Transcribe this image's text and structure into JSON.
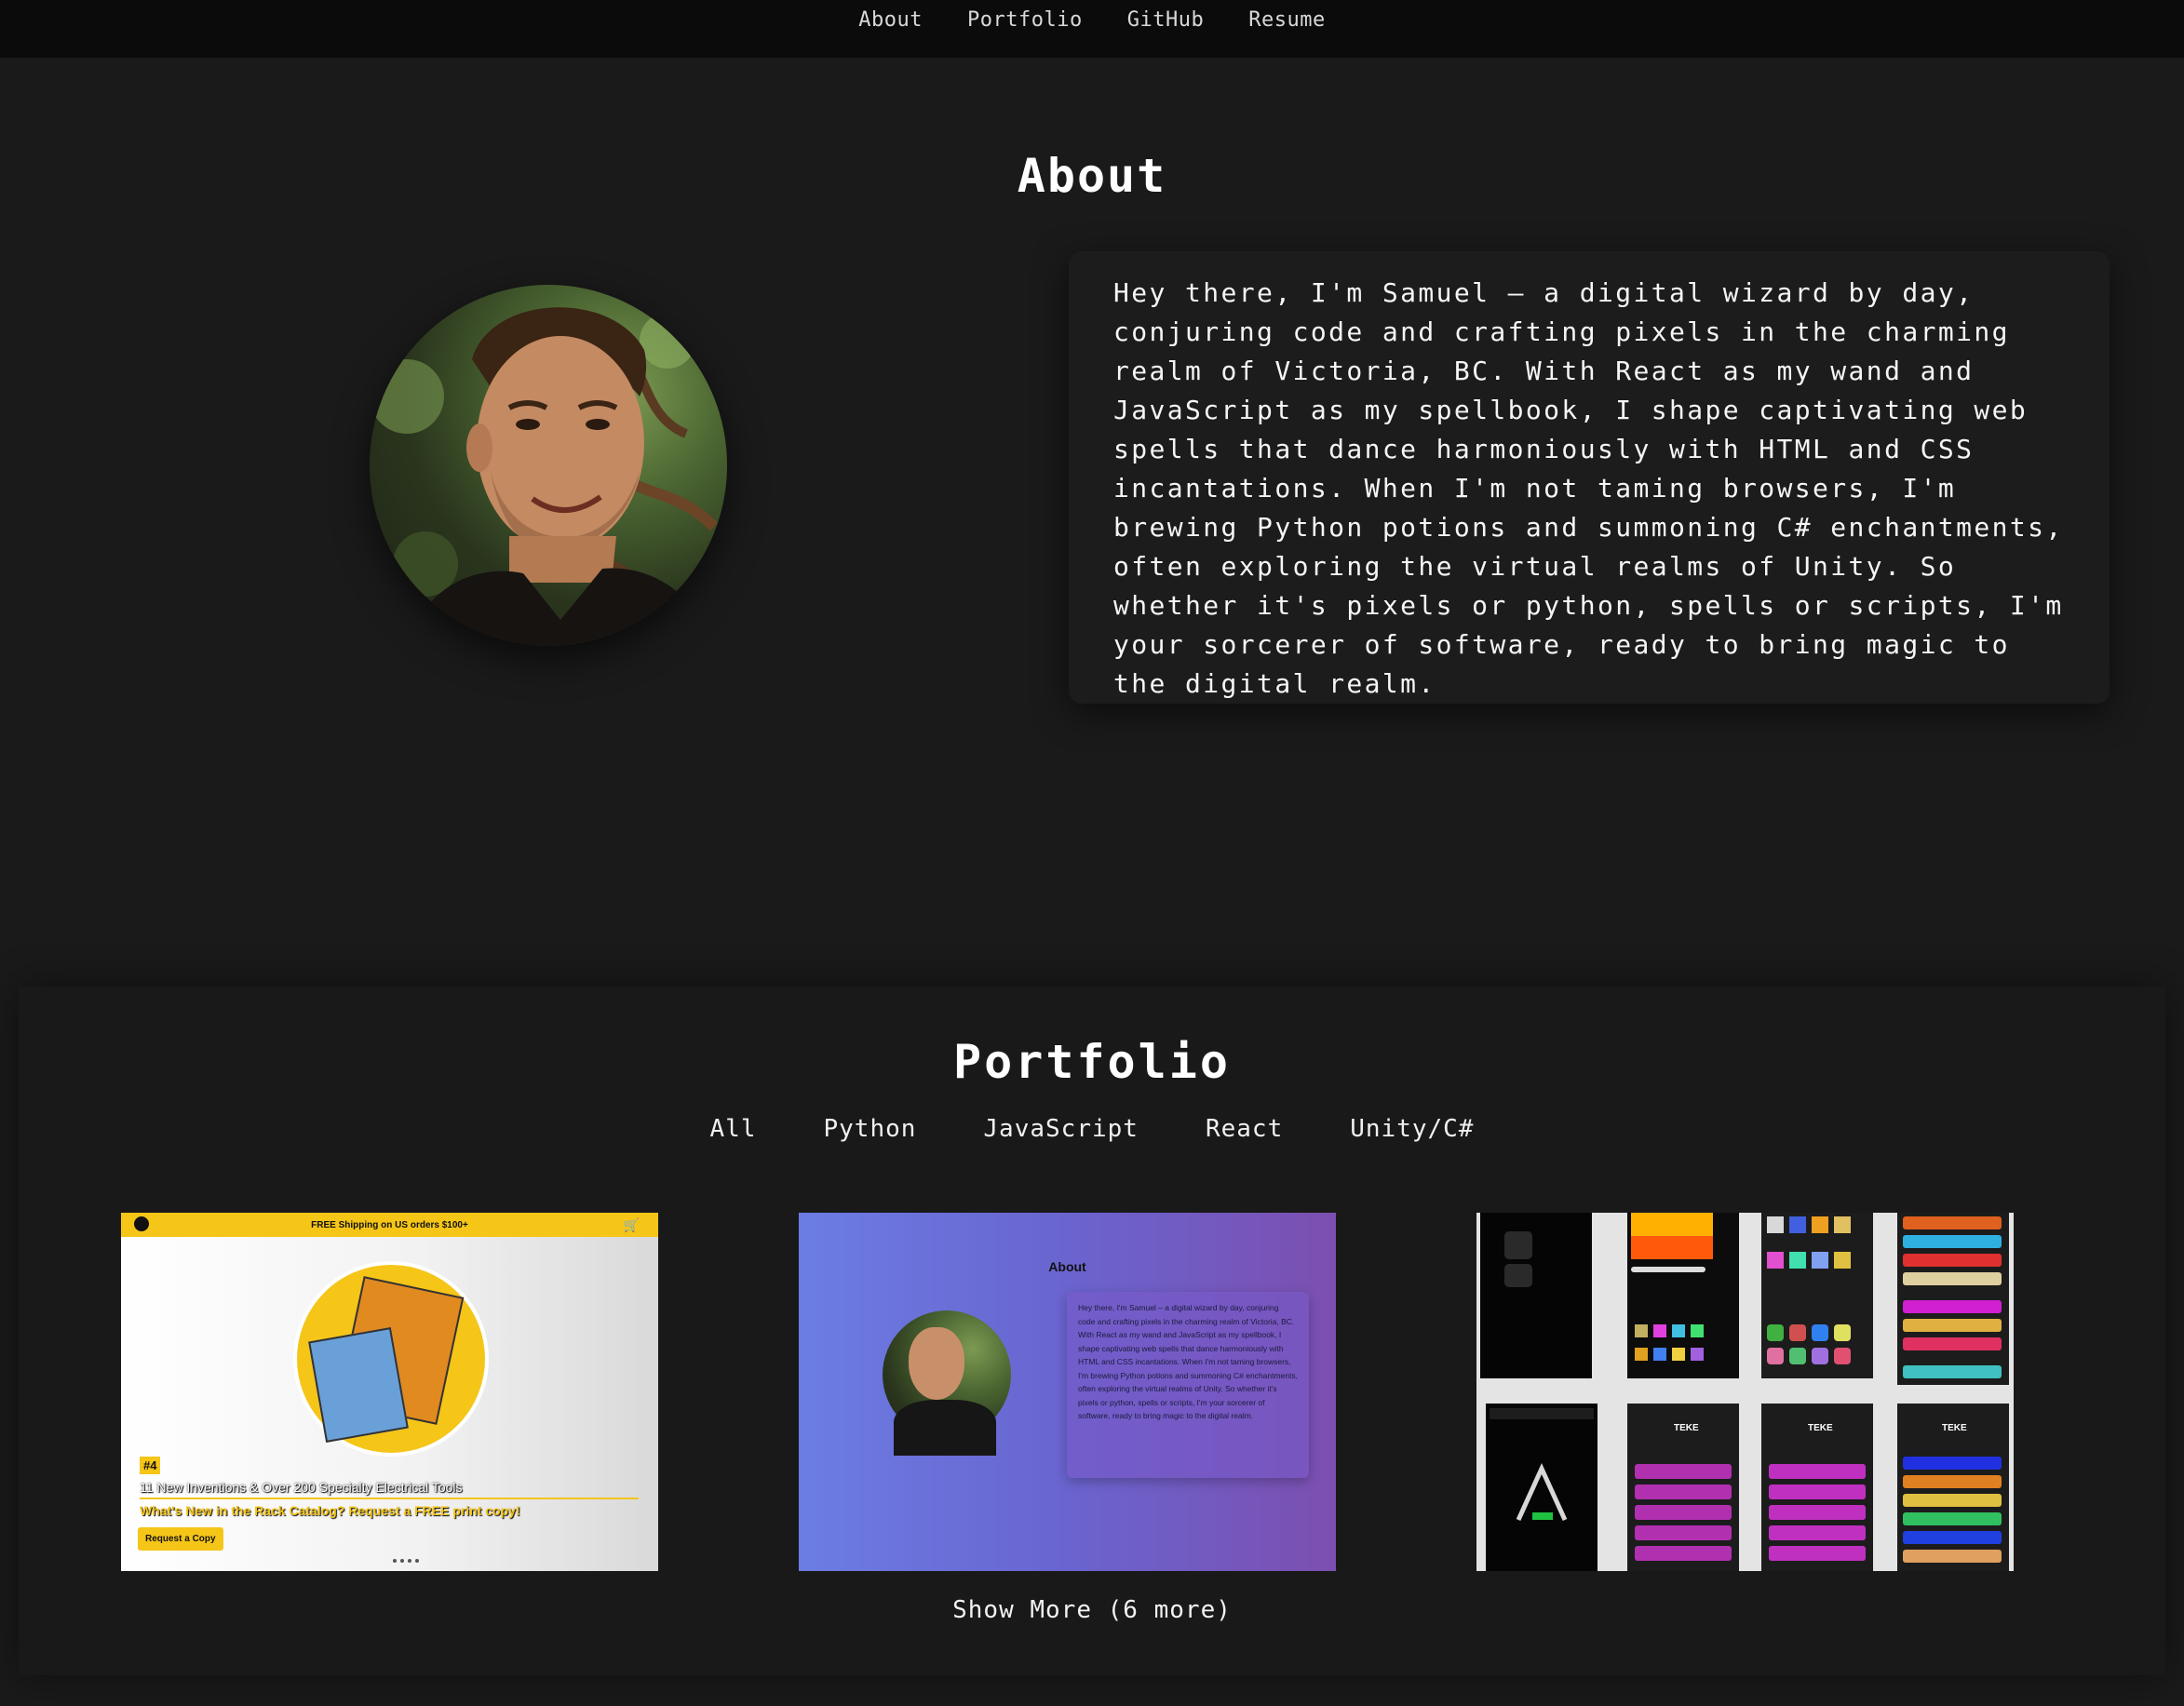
{
  "nav": {
    "links": [
      "About",
      "Portfolio",
      "GitHub",
      "Resume"
    ]
  },
  "about": {
    "title": "About",
    "bio": "Hey there, I'm Samuel – a digital wizard by day, conjuring code and crafting pixels in the charming realm of Victoria, BC. With React as my wand and JavaScript as my spellbook, I shape captivating web spells that dance harmoniously with HTML and CSS incantations. When I'm not taming browsers, I'm brewing Python potions and summoning C# enchantments, often exploring the virtual realms of Unity. So whether it's pixels or python, spells or scripts, I'm your sorcerer of software, ready to bring magic to the digital realm."
  },
  "portfolio": {
    "title": "Portfolio",
    "filters": [
      "All",
      "Python",
      "JavaScript",
      "React",
      "Unity/C#"
    ],
    "show_more": "Show More (6 more)",
    "card1": {
      "topbar": "FREE Shipping on US orders $100+",
      "badge": "#4",
      "headline": "11 New Inventions & Over 200 Specialty Electrical Tools",
      "subhead": "What's New in the Rack Catalog? Request a FREE print copy!",
      "button": "Request a Copy",
      "accent": "#f5c518"
    },
    "card2": {
      "title": "About",
      "bio": "Hey there, I'm Samuel – a digital wizard by day, conjuring code and crafting pixels in the charming realm of Victoria, BC. With React as my wand and JavaScript as my spellbook, I shape captivating web spells that dance harmoniously with HTML and CSS incantations. When I'm not taming browsers, I'm brewing Python potions and summoning C# enchantments, often exploring the virtual realms of Unity. So whether it's pixels or python, spells or scripts, I'm your sorcerer of software, ready to bring magic to the digital realm."
    },
    "card3": {
      "app_name": "TEKE"
    }
  },
  "colors": {
    "background": "#1a1a1a",
    "nav_background": "#0b0b0b",
    "text": "#ffffff"
  }
}
